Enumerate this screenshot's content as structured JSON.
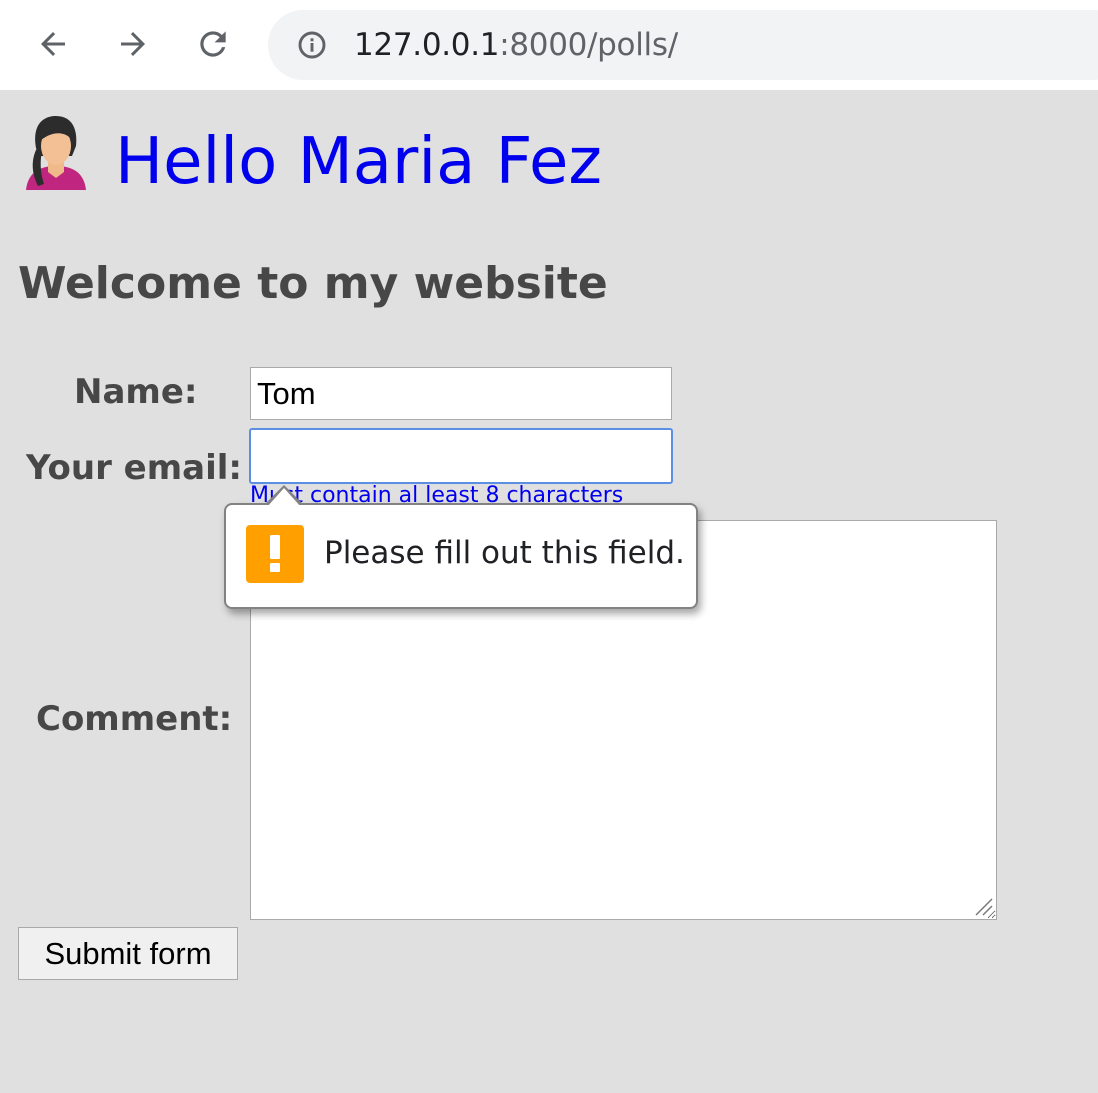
{
  "browser": {
    "url_host": "127.0.0.1",
    "url_rest": ":8000/polls/",
    "back_icon": "arrow-left-icon",
    "forward_icon": "arrow-right-icon",
    "reload_icon": "reload-icon",
    "info_icon": "info-icon"
  },
  "page": {
    "avatar_icon": "woman-avatar-icon",
    "greeting": "Hello Maria Fez",
    "greeting_color": "#0000ee",
    "welcome": "Welcome to my website",
    "background": "#e0e0e0"
  },
  "form": {
    "name_label": "Name:",
    "name_value": "Tom",
    "email_label": "Your email:",
    "email_value": "",
    "email_hint": "Must contain al least 8 characters",
    "comment_label": "Comment:",
    "comment_value": "",
    "submit_label": "Submit form"
  },
  "validation_tooltip": {
    "icon": "warning-icon",
    "icon_color": "#ffa000",
    "message": "Please fill out this field."
  }
}
